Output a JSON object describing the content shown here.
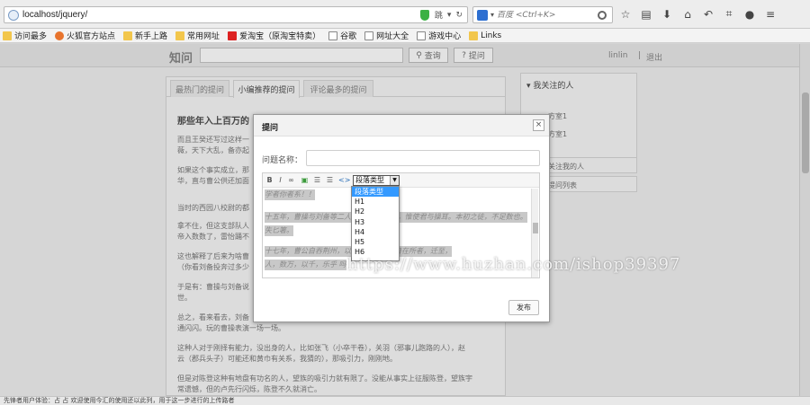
{
  "browser": {
    "url": "localhost/jquery/",
    "url_extra": "跳",
    "search_engine_label": "百度",
    "search_placeholder": "百度 <Ctrl+K>",
    "bookmarks": [
      {
        "label": "访问最多",
        "icon": "folder"
      },
      {
        "label": "火狐官方站点",
        "icon": "folder"
      },
      {
        "label": "新手上路",
        "icon": "folder"
      },
      {
        "label": "常用网址",
        "icon": "folder"
      },
      {
        "label": "爱淘宝（原淘宝特卖）",
        "icon": "taobao"
      },
      {
        "label": "谷歌",
        "icon": "page"
      },
      {
        "label": "网址大全",
        "icon": "page"
      },
      {
        "label": "游戏中心",
        "icon": "page"
      },
      {
        "label": "Links",
        "icon": "folder"
      }
    ]
  },
  "nav": {
    "logo": "知问",
    "query_button": "查询",
    "ask_button": "提问",
    "username": "linlin",
    "separator": "|",
    "logout": "退出"
  },
  "tabs": [
    "最热门的提问",
    "小编推荐的提问",
    "评论最多的提问"
  ],
  "article": {
    "title": "那些年入上百万的",
    "paragraphs": [
      "而且王癸还写过这样一",
      "薇，天下大乱，备亦起",
      "如果这个事实成立，那",
      "华，直与曹公供还加面",
      "当时的西园八校尉的都",
      "拿不住，但这支部队人",
      "帝入数数了，雷怡踊不",
      "这也解释了后来为啥曹",
      "（你看刘备投奔过多少",
      "于是有：曹操与刘备说",
      "世。",
      "总之，看来看去，刘备",
      "通闪闪。玩的曹操表演一场一场。",
      "这种人对于刚择有能力，没出身的人，比如张飞（小卒干卷），关羽（邪事儿跑路的人），赵",
      "云（郡兵头子）可能还和黄巾有关系，我猜的），那吸引力，刚刚地。",
      "但是对陈登这种有地盘有功名的人，望族的吸引力就有限了。没能从事实上征服陈登，望族宇",
      "常遗憾，但的卢先行闪烁，陈登不久就消亡。"
    ]
  },
  "sidebar": {
    "follow_header": "我关注的人",
    "items": [
      "方室1",
      "方室1"
    ],
    "box1": "关注我的人",
    "box2": "提问列表"
  },
  "modal": {
    "title": "提问",
    "close": "×",
    "field_label": "问题名称：",
    "toolbar": [
      "B",
      "I",
      "∞",
      "▣",
      "☰",
      "☰",
      "<>"
    ],
    "format_selected": "段落类型",
    "format_options": [
      "段落类型",
      "H1",
      "H2",
      "H3",
      "H4",
      "H5",
      "H6"
    ],
    "editor_lines": [
      "学者你者系！！",
      "十五年，曹操与刘备等二人：\"今天下英雄，惟使君与操耳。本初之徒，不足数也。\"先主方食，",
      "失匕箸。",
      "十七年，曹公自吞荆州，以大将军行，将自在所者，迁至，",
      "人，数万，以千，乐乎 吗"
    ],
    "publish": "发布"
  },
  "watermark": "https://www.huzhan.com/ishop39397",
  "statusbar": "先锋者用户体验：占  占  欢迎使用今汇的使用还以此列，用于这一步进行的上传路者"
}
